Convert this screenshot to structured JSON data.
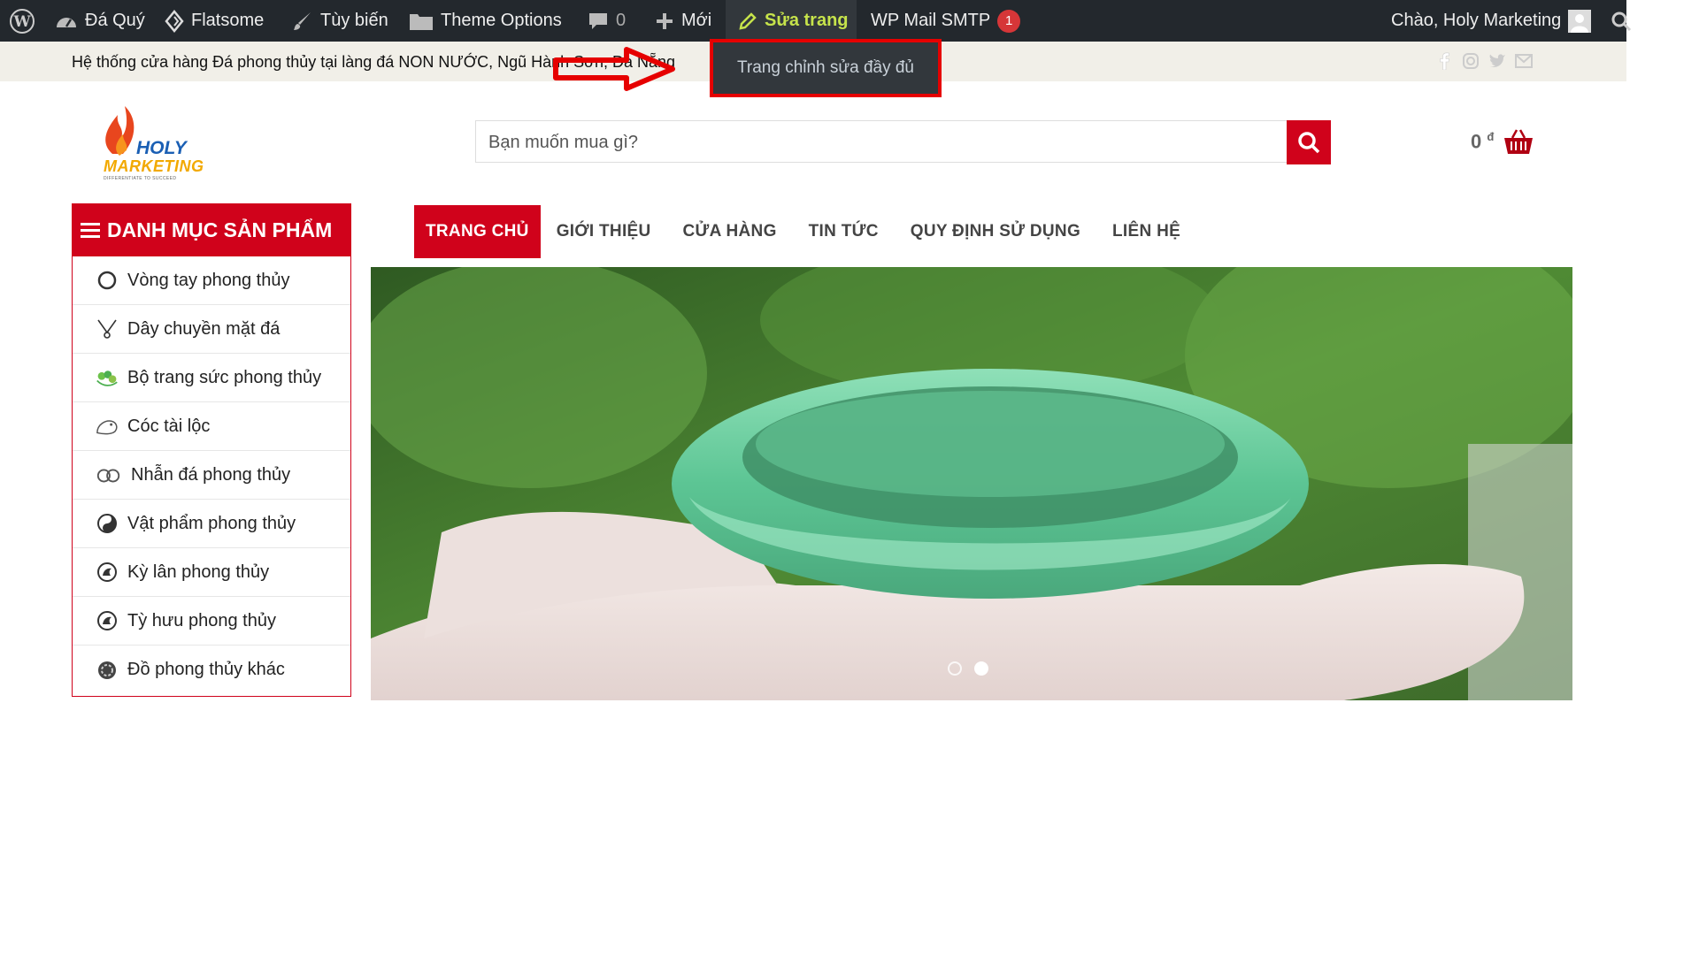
{
  "adminbar": {
    "site_name": "Đá Quý",
    "theme": "Flatsome",
    "customize": "Tùy biến",
    "theme_options": "Theme Options",
    "comments_count": "0",
    "new": "Mới",
    "edit_page": "Sửa trang",
    "wp_mail": "WP Mail SMTP",
    "wp_mail_badge": "1",
    "greeting": "Chào, Holy Marketing"
  },
  "tooltip": {
    "text": "Trang chỉnh sửa đầy đủ"
  },
  "topstrip": {
    "text": "Hệ thống cửa hàng Đá phong thủy tại làng đá NON NƯỚC, Ngũ Hành Sơn, Đà Nẵng"
  },
  "logo": {
    "line1": "HOLY",
    "line2": "MARKETING",
    "tagline": "DIFFERENTIATE TO SUCCEED"
  },
  "search": {
    "placeholder": "Bạn muốn mua gì?"
  },
  "cart": {
    "amount": "0",
    "currency": "đ"
  },
  "categories": {
    "title": "DANH MỤC SẢN PHẨM",
    "items": [
      {
        "label": "Vòng tay phong thủy"
      },
      {
        "label": "Dây chuyền mặt đá"
      },
      {
        "label": "Bộ trang sức phong thủy"
      },
      {
        "label": "Cóc tài lộc"
      },
      {
        "label": "Nhẫn đá phong thủy"
      },
      {
        "label": "Vật phẩm phong thủy"
      },
      {
        "label": "Kỳ lân phong thủy"
      },
      {
        "label": "Tỳ hưu phong thủy"
      },
      {
        "label": "Đồ phong thủy khác"
      }
    ]
  },
  "nav": {
    "items": [
      {
        "label": "TRANG CHỦ"
      },
      {
        "label": "GIỚI THIỆU"
      },
      {
        "label": "CỬA HÀNG"
      },
      {
        "label": "TIN TỨC"
      },
      {
        "label": "QUY ĐỊNH SỬ DỤNG"
      },
      {
        "label": "LIÊN HỆ"
      }
    ]
  },
  "colors": {
    "admin_bg": "#23282d",
    "accent_red": "#d0021b",
    "edit_highlight": "#c6e34b",
    "strip_bg": "#f1efe8"
  },
  "icons": [
    "wordpress-icon",
    "dashboard-icon",
    "flatsome-icon",
    "brush-icon",
    "folder-icon",
    "comment-icon",
    "plus-icon",
    "pencil-icon",
    "avatar",
    "search-icon",
    "facebook-icon",
    "instagram-icon",
    "twitter-icon",
    "mail-icon",
    "cart-icon",
    "menu-icon",
    "pointer-arrow"
  ]
}
